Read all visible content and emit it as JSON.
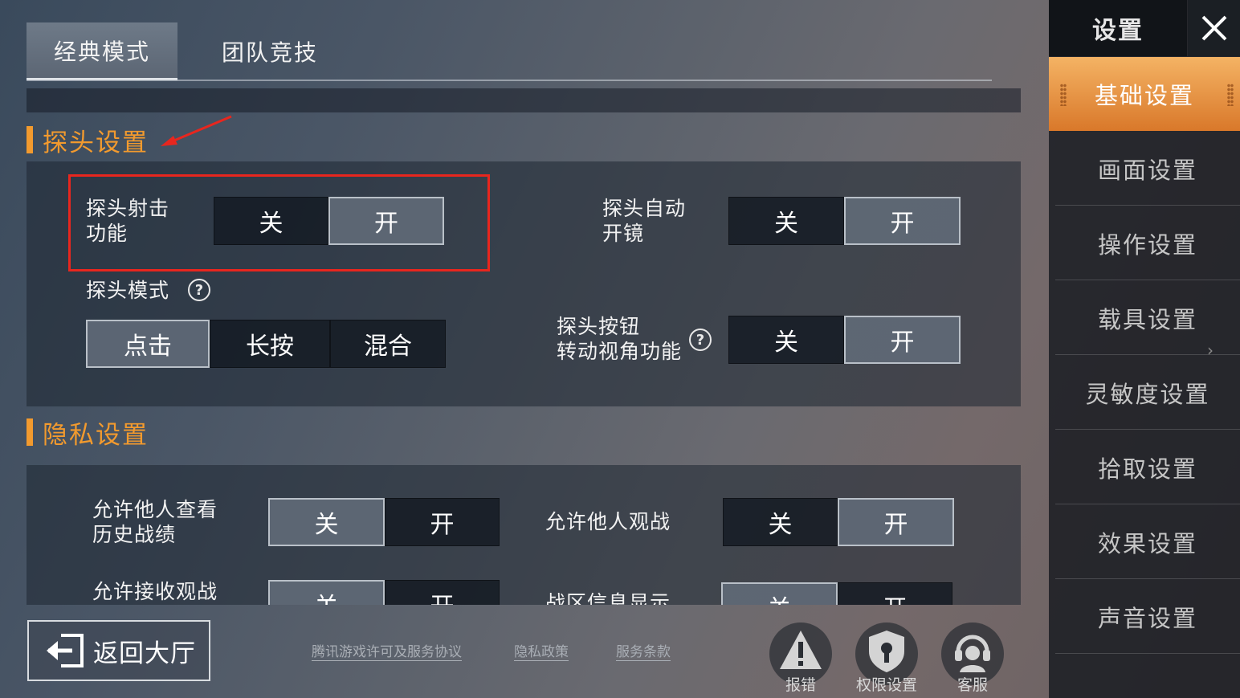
{
  "tabs": [
    {
      "label": "经典模式",
      "active": true
    },
    {
      "label": "团队竞技",
      "active": false
    }
  ],
  "peek_section": {
    "title": "探头设置",
    "peek_shoot": {
      "label": "探头射击\n功能",
      "off": "关",
      "on": "开",
      "selected": "开"
    },
    "peek_auto_scope": {
      "label": "探头自动\n开镜",
      "off": "关",
      "on": "开",
      "selected": "开"
    },
    "peek_mode": {
      "label": "探头模式",
      "options": [
        "点击",
        "长按",
        "混合"
      ],
      "selected": "点击"
    },
    "peek_button_rotate": {
      "label": "探头按钮\n转动视角功能",
      "off": "关",
      "on": "开",
      "selected": "开"
    }
  },
  "privacy_section": {
    "title": "隐私设置",
    "history": {
      "label": "允许他人查看\n历史战绩",
      "off": "关",
      "on": "开",
      "selected": "关"
    },
    "spectate": {
      "label": "允许他人观战",
      "off": "关",
      "on": "开",
      "selected": "开"
    },
    "receive_spectate": {
      "label": "允许接收观战",
      "off": "关",
      "on": "开",
      "selected": "关"
    },
    "region_info": {
      "label": "战区信息显示",
      "off": "关",
      "on": "开",
      "selected": "关"
    }
  },
  "sidebar": {
    "title": "设置",
    "items": [
      {
        "label": "基础设置",
        "active": true
      },
      {
        "label": "画面设置",
        "active": false
      },
      {
        "label": "操作设置",
        "active": false
      },
      {
        "label": "载具设置",
        "active": false
      },
      {
        "label": "灵敏度设置",
        "active": false
      },
      {
        "label": "拾取设置",
        "active": false
      },
      {
        "label": "效果设置",
        "active": false
      },
      {
        "label": "声音设置",
        "active": false
      }
    ]
  },
  "bottom": {
    "back_label": "返回大厅",
    "links": [
      "腾讯游戏许可及服务协议",
      "隐私政策",
      "服务条款"
    ],
    "buttons": [
      {
        "label": "报错",
        "icon": "warning-icon"
      },
      {
        "label": "权限设置",
        "icon": "shield-icon"
      },
      {
        "label": "客服",
        "icon": "headset-icon"
      }
    ]
  },
  "colors": {
    "accent": "#f29a2e",
    "highlight_box": "#e8261e"
  }
}
